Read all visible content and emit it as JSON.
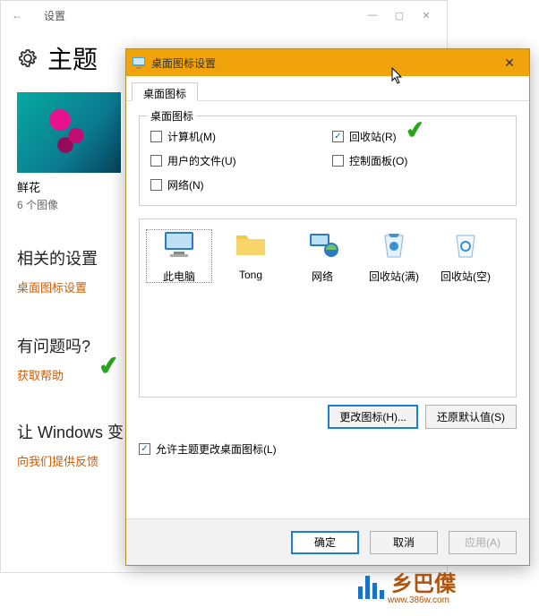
{
  "settings": {
    "back_arrow": "←",
    "title": "设置",
    "win_min": "—",
    "win_max": "▢",
    "win_close": "✕",
    "heading": "主题",
    "thumb_label": "鲜花",
    "thumb_sub": "6 个图像",
    "section_related": "相关的设置",
    "link_desktop_icons": "桌面图标设置",
    "section_question": "有问题吗?",
    "link_help": "获取帮助",
    "section_windows": "让 Windows 变",
    "link_feedback": "向我们提供反馈"
  },
  "dialog": {
    "title": "桌面图标设置",
    "close": "✕",
    "tab": "桌面图标",
    "group_title": "桌面图标",
    "checkboxes": {
      "computer": {
        "label": "计算机(M)",
        "checked": false
      },
      "recycle": {
        "label": "回收站(R)",
        "checked": true
      },
      "userfiles": {
        "label": "用户的文件(U)",
        "checked": false
      },
      "control": {
        "label": "控制面板(O)",
        "checked": false
      },
      "network": {
        "label": "网络(N)",
        "checked": false
      }
    },
    "icons": {
      "thispc": "此电脑",
      "user": "Tong",
      "network": "网络",
      "recycle_full": "回收站(满)",
      "recycle_empty": "回收站(空)"
    },
    "btn_change_icon": "更改图标(H)...",
    "btn_restore": "还原默认值(S)",
    "allow_themes": {
      "label": "允许主题更改桌面图标(L)",
      "checked": true
    },
    "btn_ok": "确定",
    "btn_cancel": "取消",
    "btn_apply": "应用(A)"
  },
  "watermark": {
    "text1": "乡巴僷",
    "text2": "www.386w.com"
  }
}
